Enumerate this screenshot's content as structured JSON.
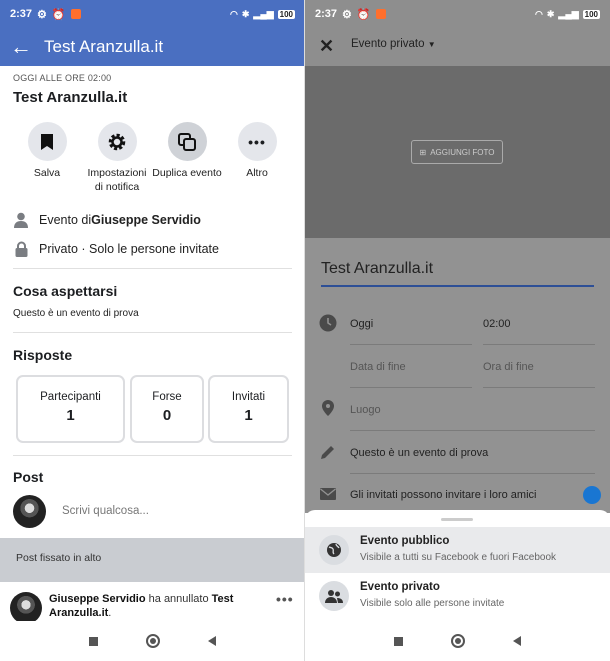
{
  "status_bar": {
    "time": "2:37",
    "battery": "100"
  },
  "left": {
    "header": {
      "title": "Test Aranzulla.it"
    },
    "date_line": "OGGI ALLE ORE 02:00",
    "event_name": "Test Aranzulla.it",
    "actions": [
      {
        "label": "Salva",
        "icon": "bookmark-icon"
      },
      {
        "label": "Impostazioni di notifica",
        "icon": "gear-icon"
      },
      {
        "label": "Duplica evento",
        "icon": "duplicate-icon"
      },
      {
        "label": "Altro",
        "icon": "more-icon"
      }
    ],
    "host": {
      "prefix": "Evento di ",
      "name": "Giuseppe Servidio"
    },
    "privacy": "Privato · Solo le persone invitate",
    "about": {
      "title": "Cosa aspettarsi",
      "text": "Questo è un evento di prova"
    },
    "responses": {
      "title": "Risposte",
      "items": [
        {
          "label": "Partecipanti",
          "value": "1"
        },
        {
          "label": "Forse",
          "value": "0"
        },
        {
          "label": "Invitati",
          "value": "1"
        }
      ]
    },
    "post": {
      "title": "Post",
      "placeholder": "Scrivi qualcosa..."
    },
    "pinned": "Post fissato in alto",
    "feed": {
      "author": "Giuseppe Servidio",
      "action": " ha annullato ",
      "target": "Test Aranzulla.it",
      "suffix": "."
    }
  },
  "right": {
    "privacy_selector": "Evento privato",
    "add_photo": "AGGIUNGI FOTO",
    "title_value": "Test Aranzulla.it",
    "start_date": "Oggi",
    "start_time": "02:00",
    "end_date_placeholder": "Data di fine",
    "end_time_placeholder": "Ora di fine",
    "location_placeholder": "Luogo",
    "description": "Questo è un evento di prova",
    "guests_can_invite": "Gli invitati possono invitare i loro amici",
    "sheet": {
      "options": [
        {
          "title": "Evento pubblico",
          "subtitle": "Visibile a tutti su Facebook e fuori Facebook",
          "icon": "globe-icon",
          "selected": true
        },
        {
          "title": "Evento privato",
          "subtitle": "Visibile solo alle persone invitate",
          "icon": "people-icon",
          "selected": false
        }
      ]
    }
  },
  "colors": {
    "fb_blue": "#4a6fc1",
    "toggle_blue": "#1976d2",
    "underline_blue": "#2d4f96"
  }
}
